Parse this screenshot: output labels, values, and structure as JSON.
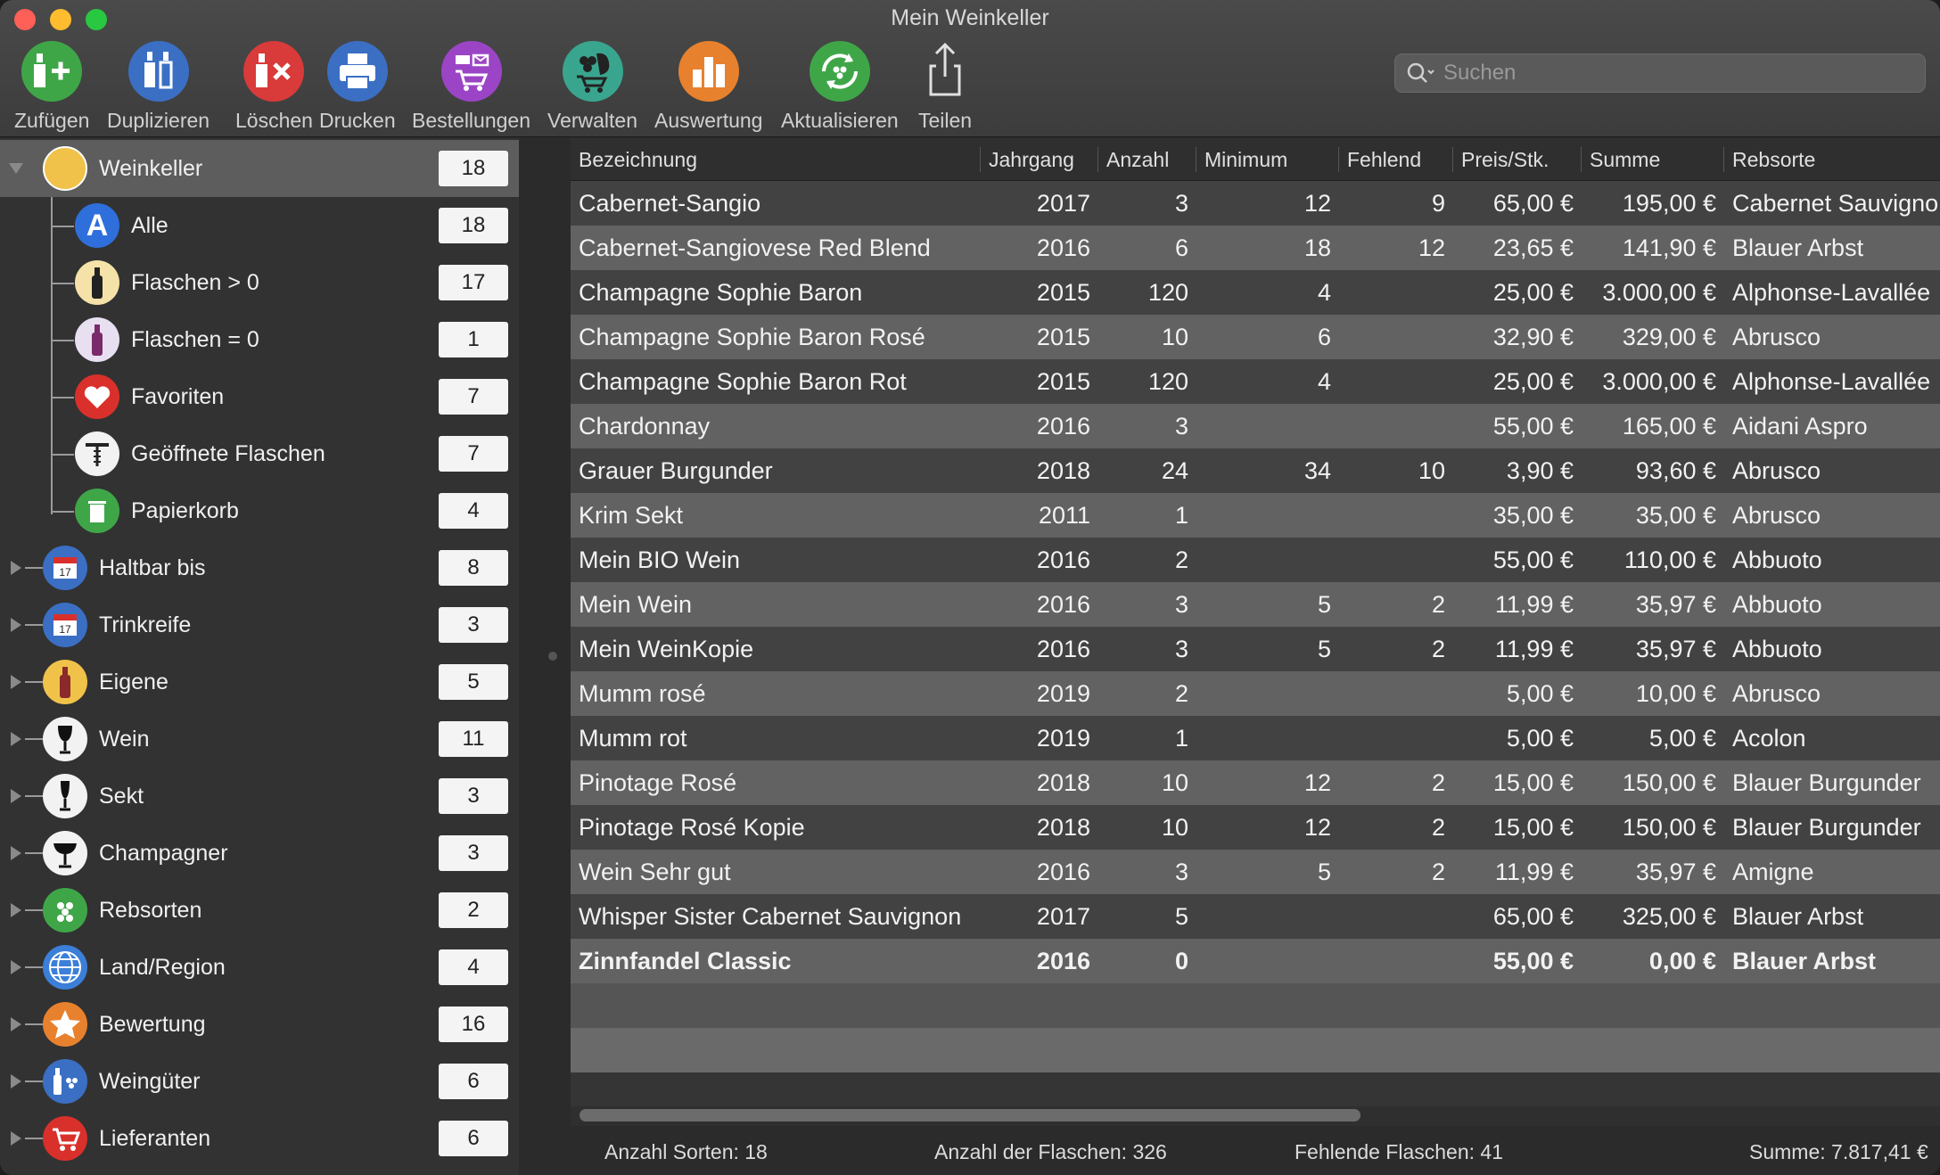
{
  "window": {
    "title": "Mein Weinkeller"
  },
  "toolbar": [
    {
      "label": "Zufügen",
      "icon": "add-bottle-icon"
    },
    {
      "label": "Duplizieren",
      "icon": "duplicate-bottles-icon"
    },
    {
      "label": "Löschen",
      "icon": "delete-bottle-icon"
    },
    {
      "label": "Drucken",
      "icon": "printer-icon"
    },
    {
      "label": "Bestellungen",
      "icon": "orders-cart-icon"
    },
    {
      "label": "Verwalten",
      "icon": "manage-grapes-icon"
    },
    {
      "label": "Auswertung",
      "icon": "bar-chart-icon"
    },
    {
      "label": "Aktualisieren",
      "icon": "refresh-icon"
    },
    {
      "label": "Teilen",
      "icon": "share-icon"
    }
  ],
  "search": {
    "placeholder": "Suchen"
  },
  "sidebar": {
    "root": {
      "label": "Weinkeller",
      "count": "18"
    },
    "children": [
      {
        "label": "Alle",
        "count": "18"
      },
      {
        "label": "Flaschen > 0",
        "count": "17"
      },
      {
        "label": "Flaschen = 0",
        "count": "1"
      },
      {
        "label": "Favoriten",
        "count": "7"
      },
      {
        "label": "Geöffnete Flaschen",
        "count": "7"
      },
      {
        "label": "Papierkorb",
        "count": "4"
      }
    ],
    "groups": [
      {
        "label": "Haltbar bis",
        "count": "8"
      },
      {
        "label": "Trinkreife",
        "count": "3"
      },
      {
        "label": "Eigene",
        "count": "5"
      },
      {
        "label": "Wein",
        "count": "11"
      },
      {
        "label": "Sekt",
        "count": "3"
      },
      {
        "label": "Champagner",
        "count": "3"
      },
      {
        "label": "Rebsorten",
        "count": "2"
      },
      {
        "label": "Land/Region",
        "count": "4"
      },
      {
        "label": "Bewertung",
        "count": "16"
      },
      {
        "label": "Weingüter",
        "count": "6"
      },
      {
        "label": "Lieferanten",
        "count": "6"
      }
    ]
  },
  "table": {
    "columns": [
      "Bezeichnung",
      "Jahrgang",
      "Anzahl",
      "Minimum",
      "Fehlend",
      "Preis/Stk.",
      "Summe",
      "Rebsorte"
    ],
    "rows": [
      [
        "Cabernet-Sangio",
        "2017",
        "3",
        "12",
        "9",
        "65,00 €",
        "195,00 €",
        "Cabernet Sauvignon"
      ],
      [
        "Cabernet-Sangiovese Red Blend",
        "2016",
        "6",
        "18",
        "12",
        "23,65 €",
        "141,90 €",
        "Blauer Arbst"
      ],
      [
        "Champagne Sophie Baron",
        "2015",
        "120",
        "4",
        "",
        "25,00 €",
        "3.000,00 €",
        "Alphonse-Lavallée"
      ],
      [
        "Champagne Sophie Baron Rosé",
        "2015",
        "10",
        "6",
        "",
        "32,90 €",
        "329,00 €",
        "Abrusco"
      ],
      [
        "Champagne Sophie Baron Rot",
        "2015",
        "120",
        "4",
        "",
        "25,00 €",
        "3.000,00 €",
        "Alphonse-Lavallée"
      ],
      [
        "Chardonnay",
        "2016",
        "3",
        "",
        "",
        "55,00 €",
        "165,00 €",
        "Aidani Aspro"
      ],
      [
        "Grauer Burgunder",
        "2018",
        "24",
        "34",
        "10",
        "3,90 €",
        "93,60 €",
        "Abrusco"
      ],
      [
        "Krim Sekt",
        "2011",
        "1",
        "",
        "",
        "35,00 €",
        "35,00 €",
        "Abrusco"
      ],
      [
        "Mein BIO Wein",
        "2016",
        "2",
        "",
        "",
        "55,00 €",
        "110,00 €",
        "Abbuoto"
      ],
      [
        "Mein Wein",
        "2016",
        "3",
        "5",
        "2",
        "11,99 €",
        "35,97 €",
        "Abbuoto"
      ],
      [
        "Mein WeinKopie",
        "2016",
        "3",
        "5",
        "2",
        "11,99 €",
        "35,97 €",
        "Abbuoto"
      ],
      [
        "Mumm rosé",
        "2019",
        "2",
        "",
        "",
        "5,00 €",
        "10,00 €",
        "Abrusco"
      ],
      [
        "Mumm rot",
        "2019",
        "1",
        "",
        "",
        "5,00 €",
        "5,00 €",
        "Acolon"
      ],
      [
        "Pinotage Rosé",
        "2018",
        "10",
        "12",
        "2",
        "15,00 €",
        "150,00 €",
        "Blauer Burgunder"
      ],
      [
        "Pinotage Rosé Kopie",
        "2018",
        "10",
        "12",
        "2",
        "15,00 €",
        "150,00 €",
        "Blauer Burgunder"
      ],
      [
        "Wein Sehr gut",
        "2016",
        "3",
        "5",
        "2",
        "11,99 €",
        "35,97 €",
        "Amigne"
      ],
      [
        "Whisper Sister Cabernet Sauvignon",
        "2017",
        "5",
        "",
        "",
        "65,00 €",
        "325,00 €",
        "Blauer Arbst"
      ],
      [
        "Zinnfandel Classic",
        "2016",
        "0",
        "",
        "",
        "55,00 €",
        "0,00 €",
        "Blauer Arbst"
      ]
    ]
  },
  "status": {
    "sorten": "Anzahl Sorten: 18",
    "flaschen": "Anzahl der Flaschen: 326",
    "fehlend": "Fehlende Flaschen: 41",
    "summe": "Summe: 7.817,41 €"
  }
}
